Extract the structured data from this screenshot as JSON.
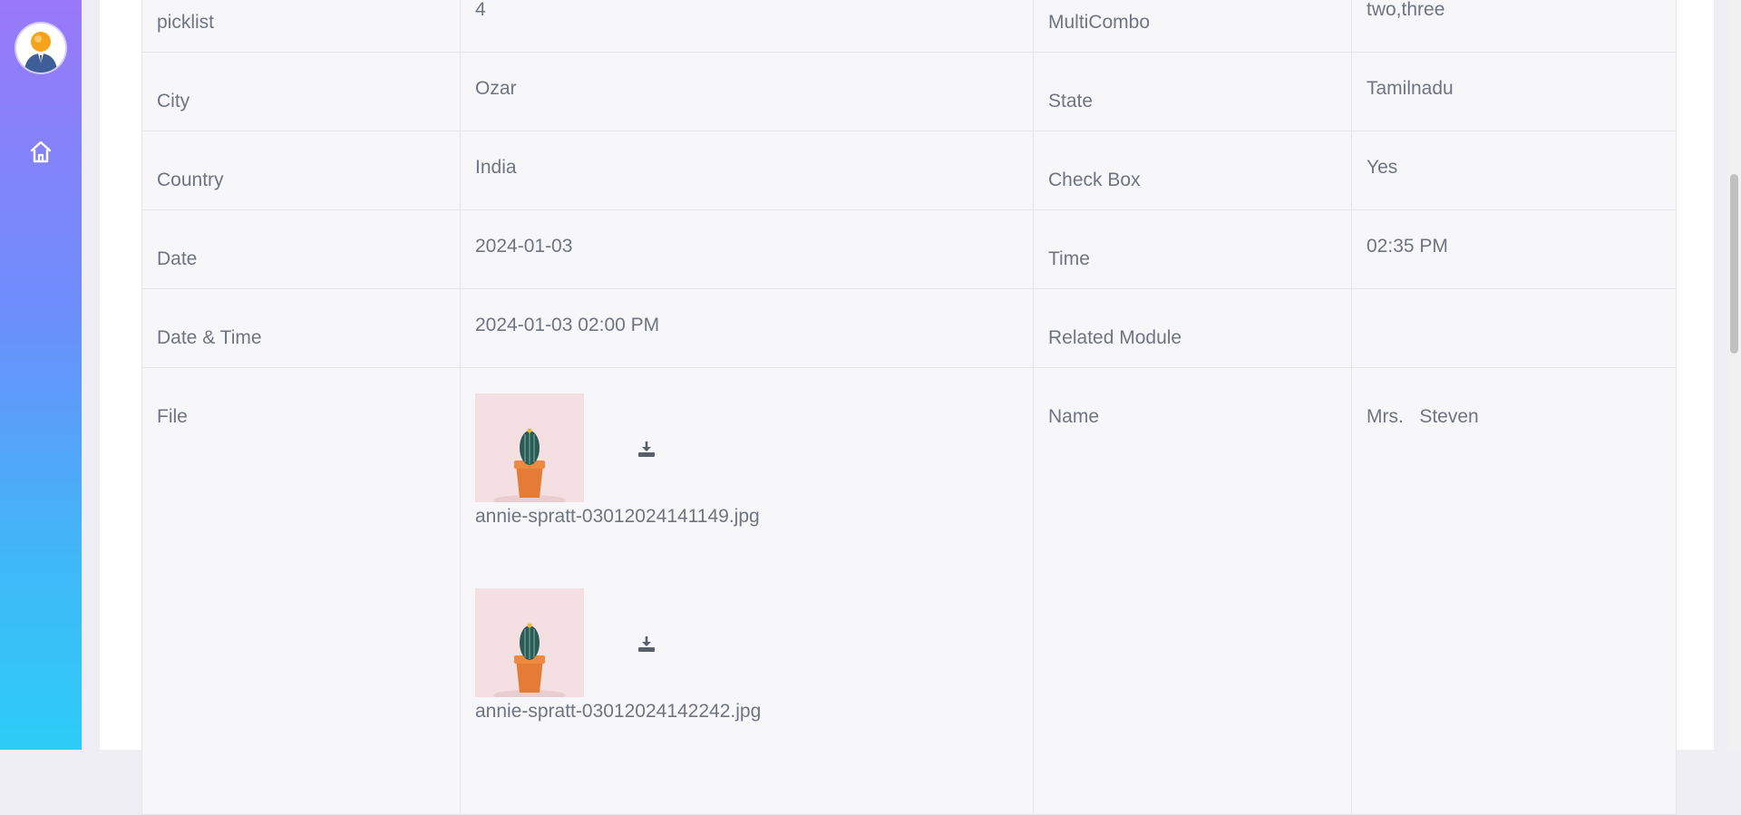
{
  "sidebar": {
    "avatar_icon": "user-avatar",
    "nav_icon": "home-icon"
  },
  "details": {
    "rows": [
      {
        "label1": "picklist",
        "value1": "4",
        "label2": "MultiCombo",
        "value2": "two,three"
      },
      {
        "label1": "City",
        "value1": "Ozar",
        "label2": "State",
        "value2": "Tamilnadu"
      },
      {
        "label1": "Country",
        "value1": "India",
        "label2": "Check Box",
        "value2": "Yes"
      },
      {
        "label1": "Date",
        "value1": "2024-01-03",
        "label2": "Time",
        "value2": "02:35 PM"
      },
      {
        "label1": "Date & Time",
        "value1": "2024-01-03 02:00 PM",
        "label2": "Related Module",
        "value2": ""
      }
    ],
    "file_row": {
      "label": "File",
      "files": [
        {
          "filename": "annie-spratt-03012024141149.jpg"
        },
        {
          "filename": "annie-spratt-03012024142242.jpg"
        }
      ],
      "name_label": "Name",
      "name_value": "Mrs.   Steven"
    }
  },
  "colors": {
    "sidebar_top": "#9a79f8",
    "sidebar_bottom": "#2ccdf7",
    "text": "#6f7482",
    "cell_bg": "#f7f7f9",
    "border": "#e4e4ea"
  }
}
